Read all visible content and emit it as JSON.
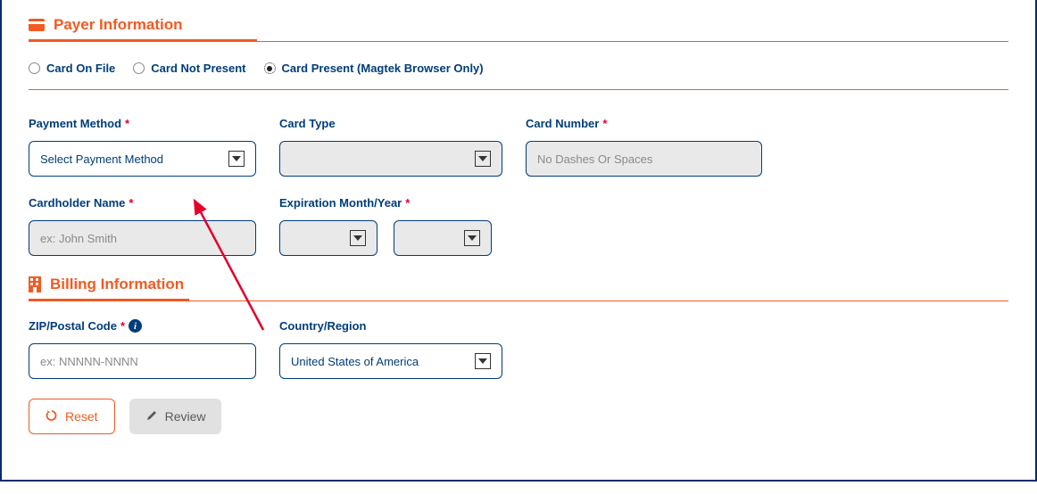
{
  "sections": {
    "payer_title": "Payer Information",
    "billing_title": "Billing Information"
  },
  "radios": {
    "card_on_file": "Card On File",
    "card_not_present": "Card Not Present",
    "card_present": "Card Present (Magtek Browser Only)"
  },
  "fields": {
    "payment_method": {
      "label": "Payment Method",
      "value": "Select Payment Method"
    },
    "card_type": {
      "label": "Card Type"
    },
    "card_number": {
      "label": "Card Number",
      "placeholder": "No Dashes Or Spaces"
    },
    "cardholder_name": {
      "label": "Cardholder Name",
      "placeholder": "ex: John Smith"
    },
    "expiration": {
      "label": "Expiration Month/Year"
    },
    "zip": {
      "label": "ZIP/Postal Code",
      "placeholder": "ex: NNNNN-NNNN"
    },
    "country": {
      "label": "Country/Region",
      "value": "United States of America"
    }
  },
  "buttons": {
    "reset": "Reset",
    "review": "Review"
  },
  "required": "*"
}
